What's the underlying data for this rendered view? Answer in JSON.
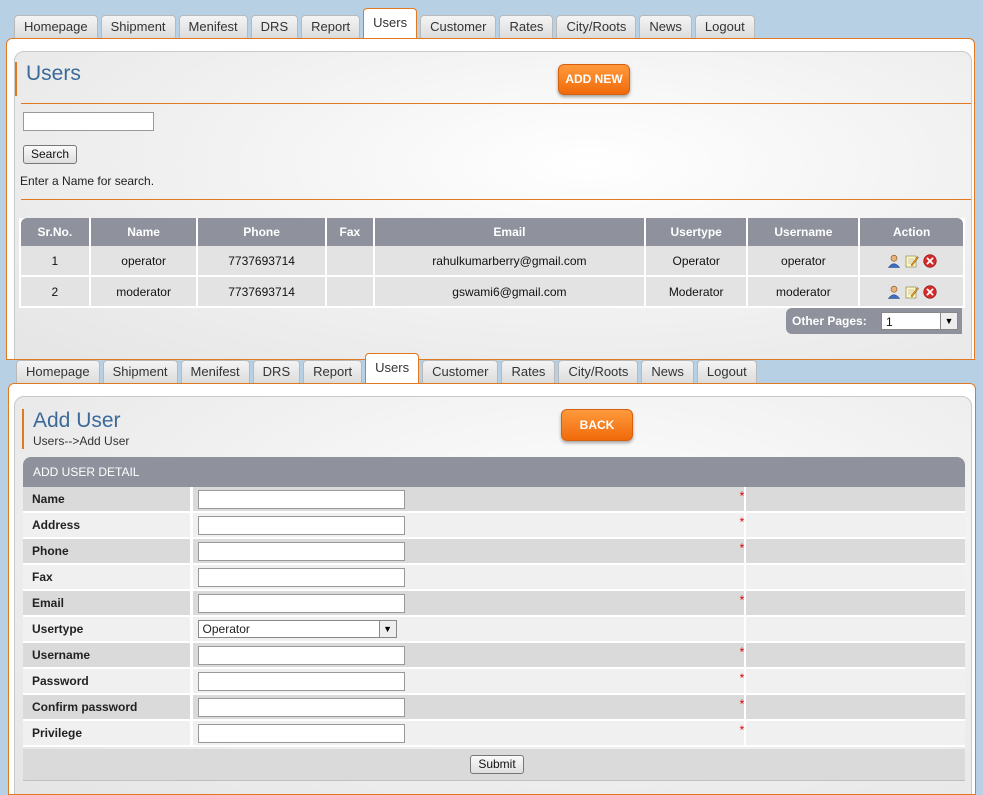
{
  "tabs": [
    "Homepage",
    "Shipment",
    "Menifest",
    "DRS",
    "Report",
    "Users",
    "Customer",
    "Rates",
    "City/Roots",
    "News",
    "Logout"
  ],
  "active_tab": "Users",
  "users_panel": {
    "title": "Users",
    "add_new_label": "ADD NEW",
    "search_button": "Search",
    "search_hint": "Enter a Name for search.",
    "columns": [
      "Sr.No.",
      "Name",
      "Phone",
      "Fax",
      "Email",
      "Usertype",
      "Username",
      "Action"
    ],
    "rows": [
      {
        "sr": "1",
        "name": "operator",
        "phone": "7737693714",
        "fax": "",
        "email": "rahulkumarberry@gmail.com",
        "usertype": "Operator",
        "username": "operator"
      },
      {
        "sr": "2",
        "name": "moderator",
        "phone": "7737693714",
        "fax": "",
        "email": "gswami6@gmail.com",
        "usertype": "Moderator",
        "username": "moderator"
      }
    ],
    "other_pages_label": "Other Pages:",
    "other_pages_value": "1"
  },
  "add_user_panel": {
    "title": "Add User",
    "breadcrumb": "Users-->Add User",
    "back_label": "BACK",
    "section_header": "ADD USER DETAIL",
    "fields": [
      {
        "label": "Name",
        "type": "text",
        "required": true
      },
      {
        "label": "Address",
        "type": "text",
        "required": true
      },
      {
        "label": "Phone",
        "type": "text",
        "required": true
      },
      {
        "label": "Fax",
        "type": "text",
        "required": false
      },
      {
        "label": "Email",
        "type": "text",
        "required": true
      },
      {
        "label": "Usertype",
        "type": "select",
        "value": "Operator",
        "required": false
      },
      {
        "label": "Username",
        "type": "text",
        "required": true
      },
      {
        "label": "Password",
        "type": "text",
        "required": true
      },
      {
        "label": "Confirm password",
        "type": "text",
        "required": true
      },
      {
        "label": "Privilege",
        "type": "text",
        "required": true
      }
    ],
    "required_mark": "*",
    "submit_label": "Submit"
  }
}
